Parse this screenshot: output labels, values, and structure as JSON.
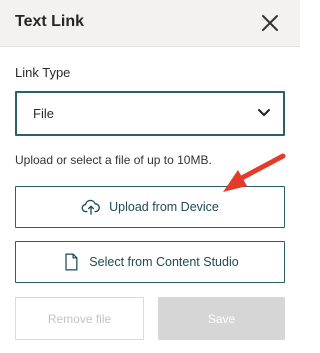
{
  "dialog": {
    "title": "Text Link",
    "close_icon": "close-icon"
  },
  "link_type": {
    "label": "Link Type",
    "selected": "File",
    "chevron_icon": "chevron-down-icon"
  },
  "help_text": "Upload or select a file of up to 10MB.",
  "actions": {
    "upload_label": "Upload from Device",
    "upload_icon": "cloud-upload-icon",
    "studio_label": "Select from Content Studio",
    "studio_icon": "document-icon"
  },
  "footer": {
    "remove_label": "Remove file",
    "save_label": "Save"
  },
  "annotation": {
    "arrow_color": "#e53b2a"
  },
  "colors": {
    "accent": "#2d5e6a",
    "header_bg": "#f3f2f1",
    "disabled_bg": "#d6d6d6"
  }
}
